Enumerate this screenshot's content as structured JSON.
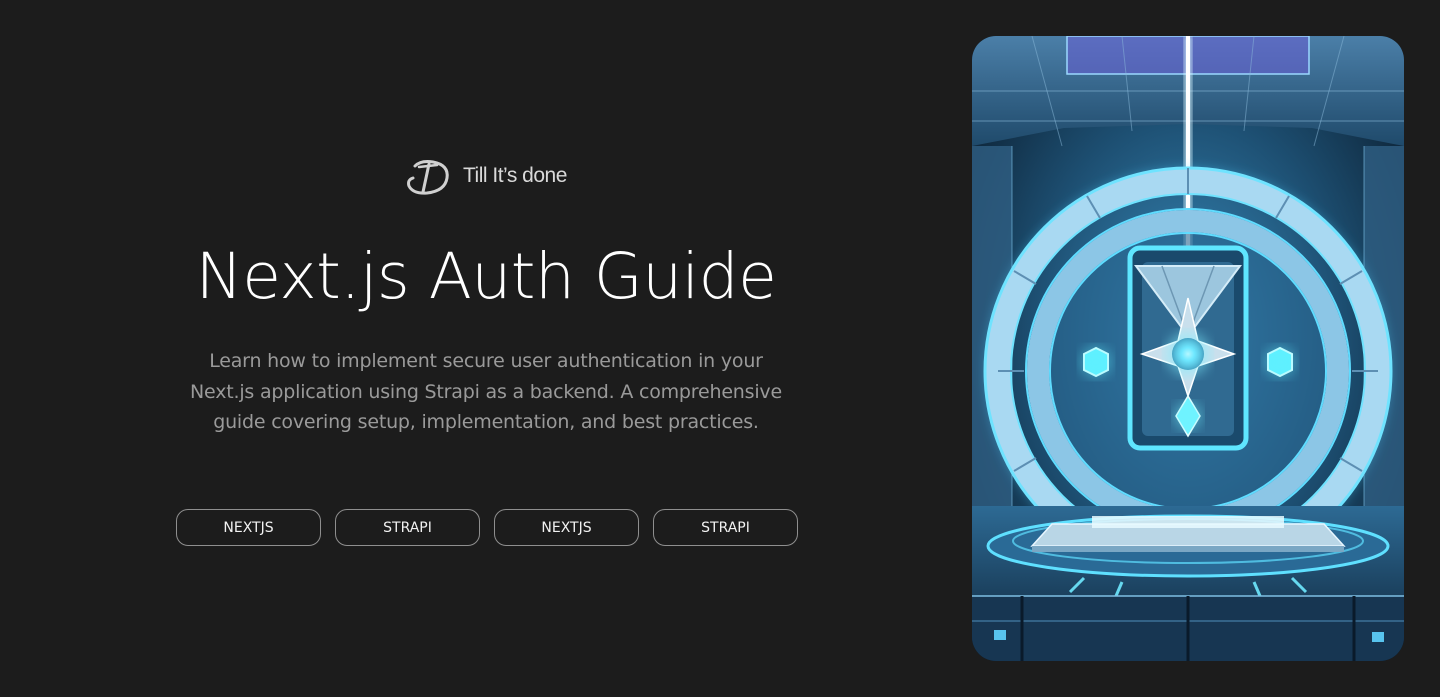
{
  "brand": {
    "name": "Till It’s done",
    "logo_icon": "td-monogram-icon"
  },
  "hero": {
    "title": "Next.js Auth Guide",
    "description": "Learn how to implement secure user authentication in your Next.js application using Strapi as a backend. A comprehensive guide covering setup, implementation, and best practices.",
    "tags": [
      {
        "label": "NEXTJS"
      },
      {
        "label": "STRAPI"
      },
      {
        "label": "NEXTJS"
      },
      {
        "label": "STRAPI"
      }
    ]
  },
  "image": {
    "subject": "glowing-blue-vault-door-image"
  },
  "colors": {
    "background": "#1c1c1c",
    "accent_glow": "#38c8ff",
    "tag_border": "#8f8f8f"
  }
}
